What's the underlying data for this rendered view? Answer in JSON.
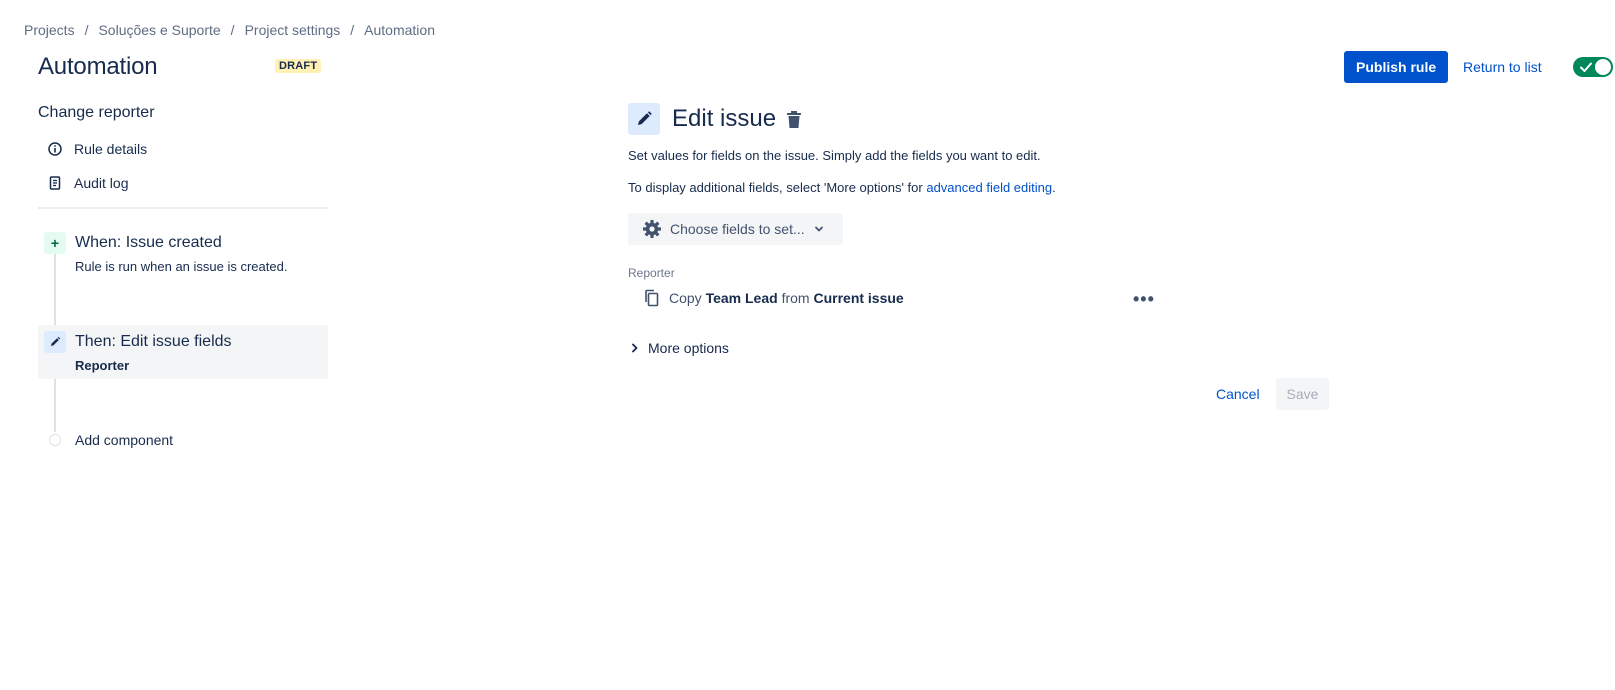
{
  "breadcrumb": {
    "items": [
      "Projects",
      "Soluções e Suporte",
      "Project settings",
      "Automation"
    ],
    "separator": "/"
  },
  "header": {
    "title": "Automation",
    "status_badge": "DRAFT",
    "publish_label": "Publish rule",
    "return_label": "Return to list",
    "enabled": true
  },
  "sidebar": {
    "rule_name": "Change reporter",
    "nav": [
      {
        "label": "Rule details",
        "icon": "info-icon"
      },
      {
        "label": "Audit log",
        "icon": "document-icon"
      }
    ],
    "trigger": {
      "title": "When: Issue created",
      "subtitle": "Rule is run when an issue is created.",
      "icon": "plus-icon"
    },
    "action": {
      "title": "Then: Edit issue fields",
      "subtitle": "Reporter",
      "icon": "pencil-icon"
    },
    "add_component_label": "Add component"
  },
  "editor": {
    "title": "Edit issue",
    "description": "Set values for fields on the issue. Simply add the fields you want to edit.",
    "note_prefix": "To display additional fields, select 'More options' for ",
    "note_link": "advanced field editing",
    "note_suffix": ".",
    "choose_fields_label": "Choose fields to set...",
    "field": {
      "label": "Reporter",
      "copy_word": "Copy",
      "source_field": "Team Lead",
      "from_word": "from",
      "source": "Current issue"
    },
    "more_options_label": "More options",
    "cancel_label": "Cancel",
    "save_label": "Save"
  },
  "colors": {
    "primary": "#0052cc",
    "toggle_on": "#00875a",
    "draft_bg": "#fff0b3",
    "text": "#172b4d"
  }
}
